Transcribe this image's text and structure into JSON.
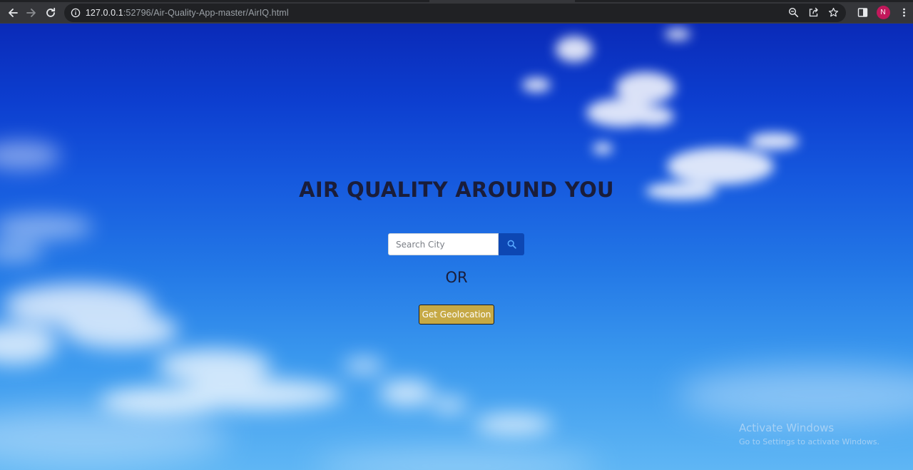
{
  "browser": {
    "url_host": "127.0.0.1",
    "url_path": ":52796/Air-Quality-App-master/AirIQ.html",
    "profile_initial": "N",
    "profile_color": "#c2185b",
    "icons": {
      "back": "arrow-left-icon",
      "forward": "arrow-right-icon",
      "reload": "reload-icon",
      "site_info": "info-icon",
      "zoom": "zoom-icon",
      "share": "share-icon",
      "bookmark": "star-icon",
      "side_panel": "side-panel-icon",
      "menu": "kebab-menu-icon"
    }
  },
  "page": {
    "headline": "AIR QUALITY AROUND YOU",
    "search": {
      "placeholder": "Search City",
      "value": "",
      "button_icon": "search-icon"
    },
    "separator": "OR",
    "geolocation_button": "Get Geolocation",
    "colors": {
      "sky_top": "#0a2ab8",
      "sky_bottom": "#5fb6f4",
      "headline": "#1a1d3a",
      "search_button": "#0d47b3",
      "geolocation_button": "#c6a945"
    }
  },
  "os_overlay": {
    "watermark_title": "Activate Windows",
    "watermark_subtitle": "Go to Settings to activate Windows."
  }
}
